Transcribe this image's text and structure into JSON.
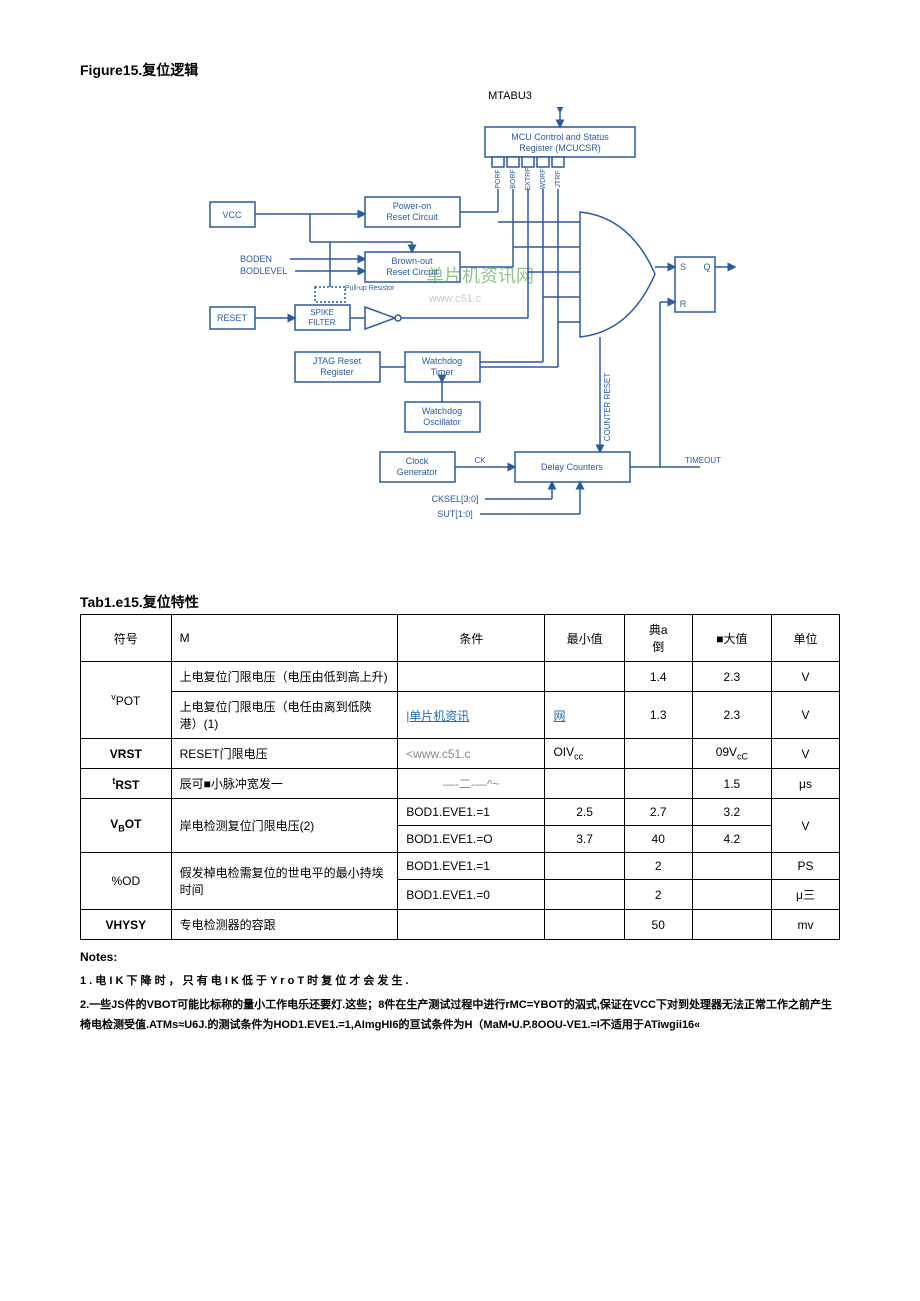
{
  "figure": {
    "title": "Figure15.复位逻辑",
    "top_label": "MTABU3",
    "blocks": {
      "mcu_csr": "MCU Control and Status Register (MCUCSR)",
      "vcc": "VCC",
      "por": "Power-on Reset Circuit",
      "boden": "BODEN",
      "bodlevel": "BODLEVEL",
      "bor": "Brown-out Reset Circuit",
      "pullup": "Pull-up Resistor",
      "reset": "RESET",
      "spike": "SPIKE FILTER",
      "jtag": "JTAG Reset Register",
      "wdt": "Watchdog Timer",
      "wdo": "Watchdog Oscillator",
      "clkgen": "Clock Generator",
      "delay": "Delay Counters",
      "counter_reset": "COUNTER RESET",
      "timeout": "TIMEOUT",
      "cksel": "CKSEL[3:0]",
      "sut": "SUT[1:0]",
      "ck": "CK",
      "s": "S",
      "r": "R",
      "q": "Q",
      "csr_bits": [
        "PORF",
        "BORF",
        "EXTRF",
        "WDRF",
        "JTRF"
      ]
    },
    "watermark1": "单片机资讯网",
    "watermark2": "www.c51.c"
  },
  "table": {
    "title": "Tab1.e15.复位特性",
    "headers": {
      "symbol": "符号",
      "param": "M",
      "cond": "条件",
      "min": "最小值",
      "typ_top": "典a",
      "typ_bot": "倒",
      "max": "■大值",
      "unit": "单位"
    },
    "rows": [
      {
        "sym": "vPOT",
        "param_a": "上电复位门限电压（电压由低到高上升)",
        "cond_a": "",
        "min_a": "",
        "typ_a": "1.4",
        "max_a": "2.3",
        "unit_a": "V",
        "param_b": "上电复位门限电压（电任由离到低陕港）(1)",
        "cond_b_link": "|单片机资讯",
        "min_b_link": "网",
        "typ_b": "1.3",
        "max_b": "2.3",
        "unit_b": "V"
      },
      {
        "sym": "VRST",
        "param": "RESET门限电压",
        "cond": "<www.c51.c",
        "min": "OIVcc",
        "typ": "",
        "max": "09Vcc",
        "unit": "V"
      },
      {
        "sym": "tRST",
        "param": "辰可■小脉冲宽发一",
        "cond": "—-二-—^~",
        "min": "",
        "typ": "",
        "max": "1.5",
        "unit": "μs"
      },
      {
        "sym": "VBOT",
        "param": "岸电检测复位门限电压(2)",
        "cond_a": "BOD1.EVE1.=1",
        "min_a": "2.5",
        "typ_a": "2.7",
        "max_a": "3.2",
        "cond_b": "BOD1.EVE1.=O",
        "min_b": "3.7",
        "typ_b": "40",
        "max_b": "4.2",
        "unit": "V"
      },
      {
        "sym": "%OD",
        "param": "假发棹电检需复位的世电平的最小持埃时间",
        "cond_a": "BOD1.EVE1.=1",
        "min_a": "",
        "typ_a": "2",
        "max_a": "",
        "unit_a": "PS",
        "cond_b": "BOD1.EVE1.=0",
        "min_b": "",
        "typ_b": "2",
        "max_b": "",
        "unit_b": "μ三"
      },
      {
        "sym": "VHYSY",
        "param": "专电检测器的容跟",
        "cond": "",
        "min": "",
        "typ": "50",
        "max": "",
        "unit": "mv"
      }
    ]
  },
  "notes": {
    "heading": "Notes:",
    "line1": "1 . 电 I K 下 降 时 ， 只 有 电 I K 低 于 Y r o T 时 复 位 才 会 发 生 .",
    "line2": "2.一些JS件的VBOT可能比标称的量小工作电乐还要灯.这些；8件在生产测试过程中进行rMC=YBOT的泅式,保证在VCC下对到处理器无法正常工作之前产生椅电检测受值.ATMs≈U6J.的测试条件为HOD1.EVE1.=1,AImgHI6的亘试条件为H（MaM•U.P.8OOU-VE1.=I不适用于ATiwgii16«"
  }
}
